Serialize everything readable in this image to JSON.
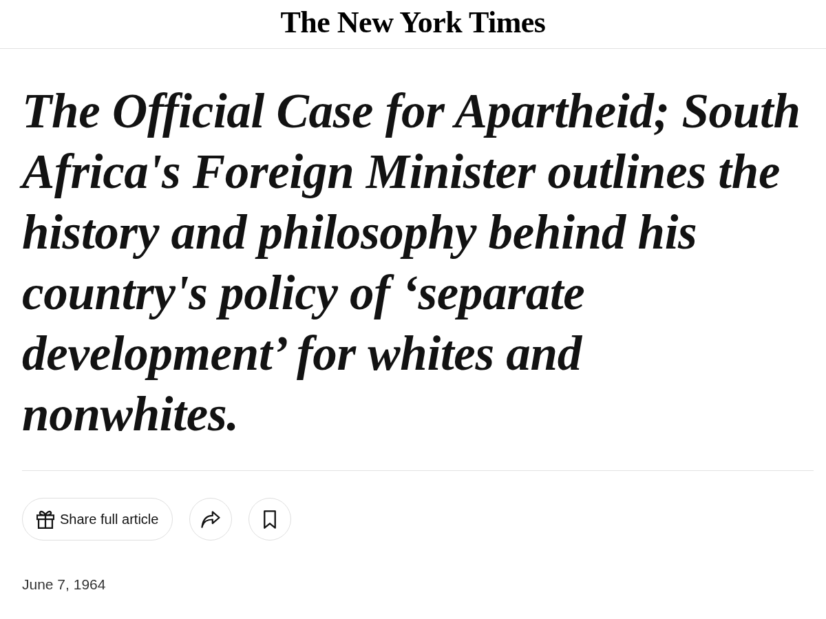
{
  "masthead": {
    "logo": "The New York Times"
  },
  "headline": "The Official Case for Apartheid; South Africa's Foreign Minister outlines the history and philosophy behind his country's policy of ‘separate development’ for whites and nonwhites.",
  "actions": [
    {
      "kind": "gift",
      "label": "Share full article"
    },
    {
      "kind": "share"
    },
    {
      "kind": "bookmark"
    }
  ],
  "date": "June 7, 1964"
}
